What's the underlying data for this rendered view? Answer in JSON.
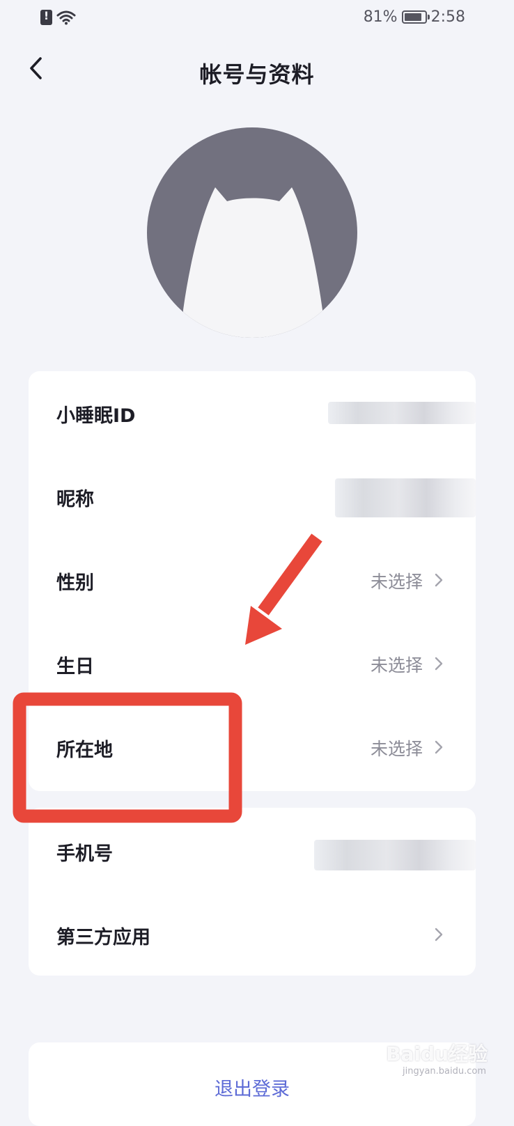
{
  "status_bar": {
    "battery_percent": "81%",
    "time": "2:58"
  },
  "header": {
    "title": "帐号与资料",
    "back_icon": "chevron-left-icon"
  },
  "profile": {
    "avatar_icon": "cat-silhouette-avatar"
  },
  "account_card": {
    "rows": [
      {
        "label": "小睡眠ID",
        "value": ""
      },
      {
        "label": "昵称",
        "value": ""
      },
      {
        "label": "性别",
        "value": "未选择"
      },
      {
        "label": "生日",
        "value": "未选择"
      },
      {
        "label": "所在地",
        "value": "未选择"
      }
    ]
  },
  "binding_card": {
    "rows": [
      {
        "label": "手机号",
        "value": ""
      },
      {
        "label": "第三方应用",
        "value": ""
      }
    ]
  },
  "logout": {
    "label": "退出登录"
  },
  "watermark": {
    "text": "Baidu经验",
    "sub": "jingyan.baidu.com"
  },
  "colors": {
    "background": "#f3f4f9",
    "card": "#ffffff",
    "accent": "#5d6bd6",
    "annotation": "#e8473a",
    "avatar_bg": "#72717f"
  }
}
